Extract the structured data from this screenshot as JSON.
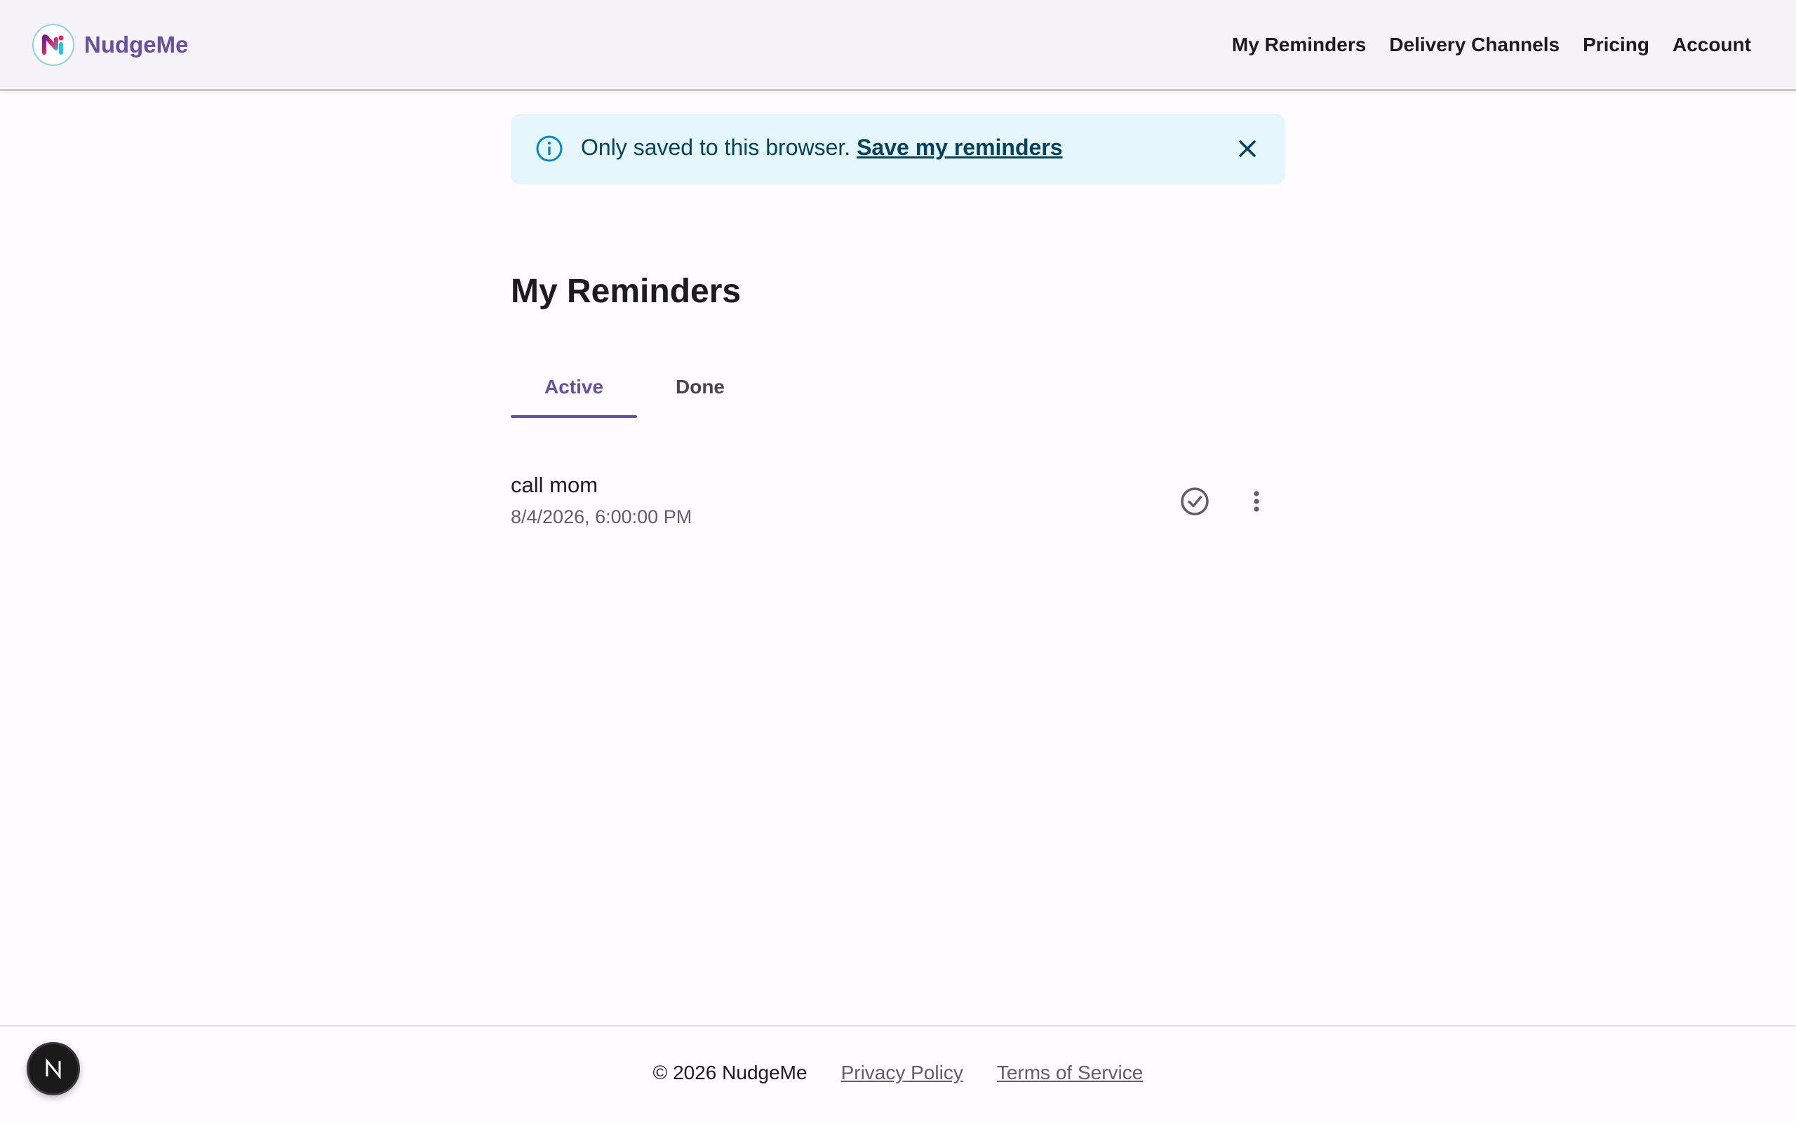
{
  "header": {
    "brand_name": "NudgeMe",
    "nav": [
      {
        "label": "My Reminders"
      },
      {
        "label": "Delivery Channels"
      },
      {
        "label": "Pricing"
      },
      {
        "label": "Account"
      }
    ]
  },
  "alert": {
    "message": "Only saved to this browser.",
    "link_label": "Save my reminders",
    "icon": "info-icon",
    "close_icon": "close-icon"
  },
  "main": {
    "title": "My Reminders",
    "tabs": [
      {
        "label": "Active",
        "selected": true
      },
      {
        "label": "Done",
        "selected": false
      }
    ],
    "reminders": [
      {
        "title": "call mom",
        "datetime": "8/4/2026, 6:00:00 PM",
        "actions": [
          "check-circle-icon",
          "more-vert-icon"
        ]
      }
    ]
  },
  "footer": {
    "copyright": "© 2026 NudgeMe",
    "links": [
      {
        "label": "Privacy Policy"
      },
      {
        "label": "Terms of Service"
      }
    ]
  },
  "dev_badge": {
    "letter": "N"
  },
  "colors": {
    "primary": "#6750a4",
    "header_bg": "#f6f3f8",
    "alert_bg": "#e5f6fd",
    "alert_text": "#014361",
    "info_icon": "#0288d1",
    "page_bg": "#fffbff"
  }
}
